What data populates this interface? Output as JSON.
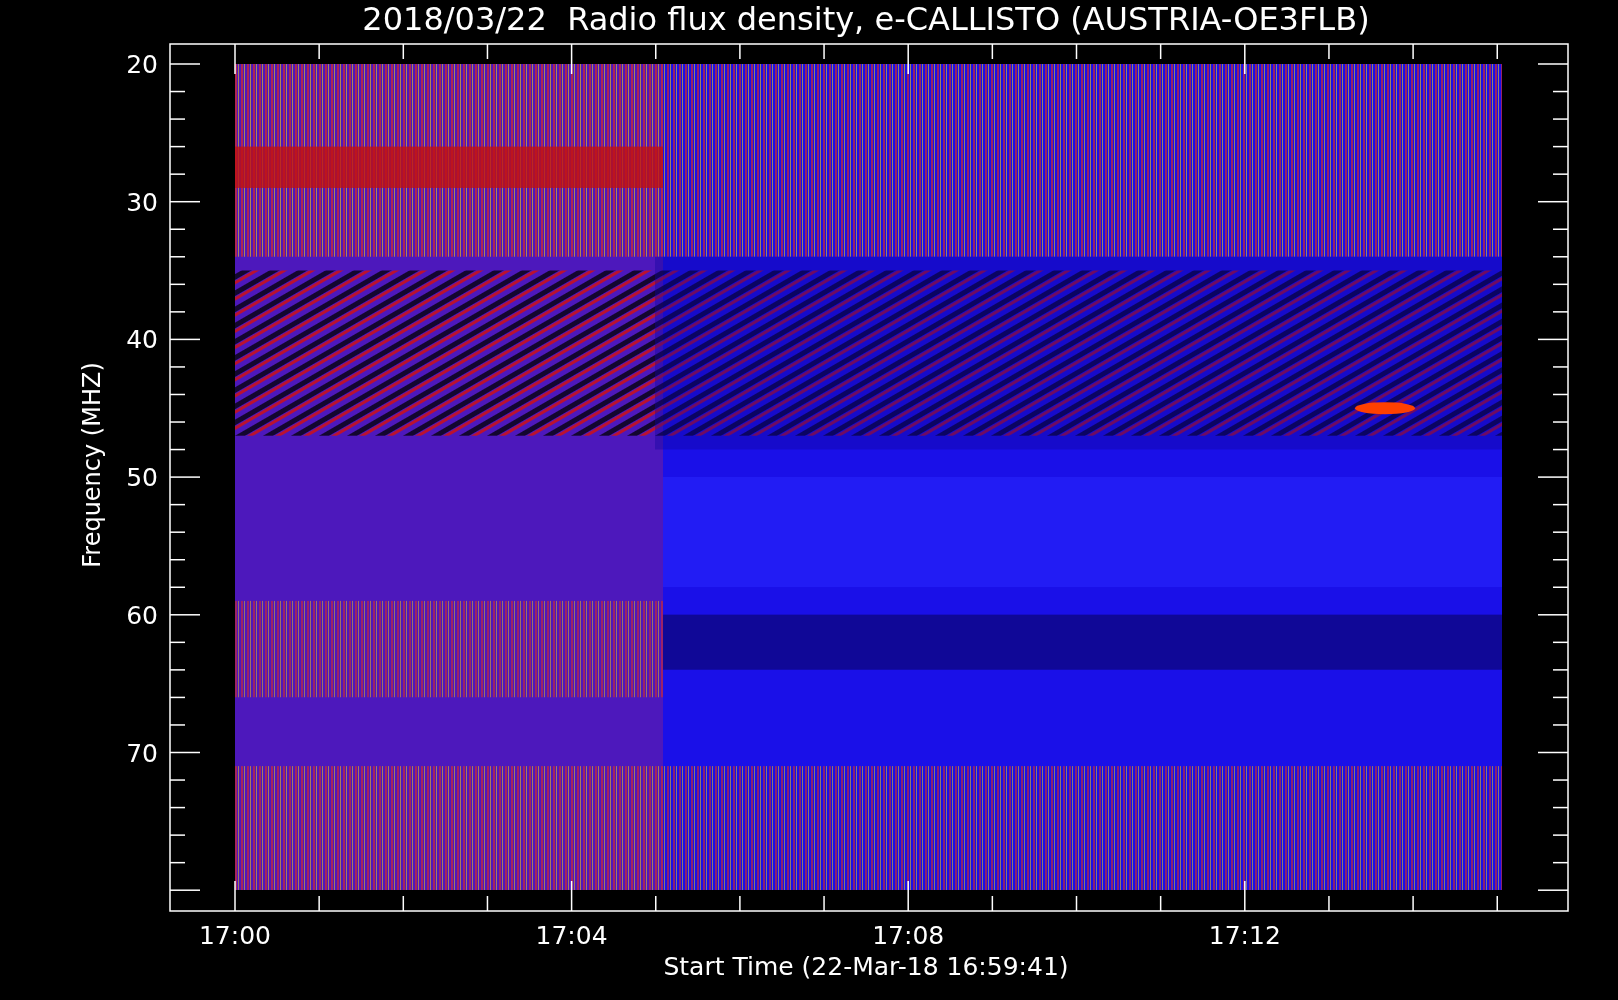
{
  "title": "2018/03/22  Radio flux density, e-CALLISTO (AUSTRIA-OE3FLB)",
  "y_axis": {
    "label": "Frequency (MHZ)",
    "ticks": [
      "20",
      "30",
      "40",
      "50",
      "60",
      "70"
    ]
  },
  "x_axis": {
    "label": "Start Time (22-Mar-18 16:59:41)",
    "ticks": [
      "17:00",
      "17:04",
      "17:08",
      "17:12"
    ]
  }
}
